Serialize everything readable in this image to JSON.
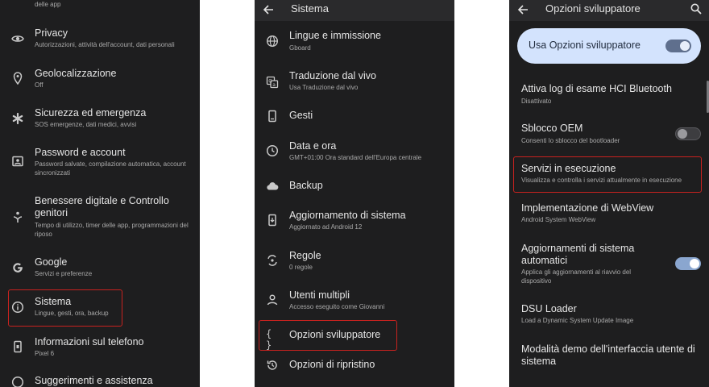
{
  "panel1": {
    "items": [
      {
        "subtitle": "delle app"
      },
      {
        "title": "Privacy",
        "subtitle": "Autorizzazioni, attività dell'account, dati personali"
      },
      {
        "title": "Geolocalizzazione",
        "subtitle": "Off"
      },
      {
        "title": "Sicurezza ed emergenza",
        "subtitle": "SOS emergenze, dati medici, avvisi"
      },
      {
        "title": "Password e account",
        "subtitle": "Password salvate, compilazione automatica, account sincronizzati"
      },
      {
        "title": "Benessere digitale e Controllo genitori",
        "subtitle": "Tempo di utilizzo, timer delle app, programmazioni del riposo"
      },
      {
        "title": "Google",
        "subtitle": "Servizi e preferenze"
      },
      {
        "title": "Sistema",
        "subtitle": "Lingue, gesti, ora, backup"
      },
      {
        "title": "Informazioni sul telefono",
        "subtitle": "Pixel 6"
      },
      {
        "title": "Suggerimenti e assistenza",
        "subtitle": ""
      }
    ]
  },
  "panel2": {
    "title": "Sistema",
    "items": [
      {
        "title": "Lingue e immissione",
        "subtitle": "Gboard"
      },
      {
        "title": "Traduzione dal vivo",
        "subtitle": "Usa Traduzione dal vivo"
      },
      {
        "title": "Gesti",
        "subtitle": ""
      },
      {
        "title": "Data e ora",
        "subtitle": "GMT+01:00 Ora standard dell'Europa centrale"
      },
      {
        "title": "Backup",
        "subtitle": ""
      },
      {
        "title": "Aggiornamento di sistema",
        "subtitle": "Aggiornato ad Android 12"
      },
      {
        "title": "Regole",
        "subtitle": "0 regole"
      },
      {
        "title": "Utenti multipli",
        "subtitle": "Accesso eseguito come Giovanni"
      },
      {
        "title": "Opzioni sviluppatore",
        "subtitle": "",
        "glyph": "{ }"
      },
      {
        "title": "Opzioni di ripristino",
        "subtitle": ""
      }
    ]
  },
  "panel3": {
    "title": "Opzioni sviluppatore",
    "master_label": "Usa Opzioni sviluppatore",
    "items": [
      {
        "title": "Attiva log di esame HCI Bluetooth",
        "subtitle": "Disattivato"
      },
      {
        "title": "Sblocco OEM",
        "subtitle": "Consenti lo sblocco del bootloader"
      },
      {
        "title": "Servizi in esecuzione",
        "subtitle": "Visualizza e controlla i servizi attualmente in esecuzione"
      },
      {
        "title": "Implementazione di WebView",
        "subtitle": "Android System WebView"
      },
      {
        "title": "Aggiornamenti di sistema automatici",
        "subtitle": "Applica gli aggiornamenti al riavvio del dispositivo"
      },
      {
        "title": "DSU Loader",
        "subtitle": "Load a Dynamic System Update Image"
      },
      {
        "title": "Modalità demo dell'interfaccia utente di sistema",
        "subtitle": ""
      }
    ]
  },
  "colors": {
    "panel_bg": "#1e1e1f",
    "accent": "#d3e3fd",
    "highlight": "#c8221f",
    "toggle_on": "#8aa6cf"
  }
}
